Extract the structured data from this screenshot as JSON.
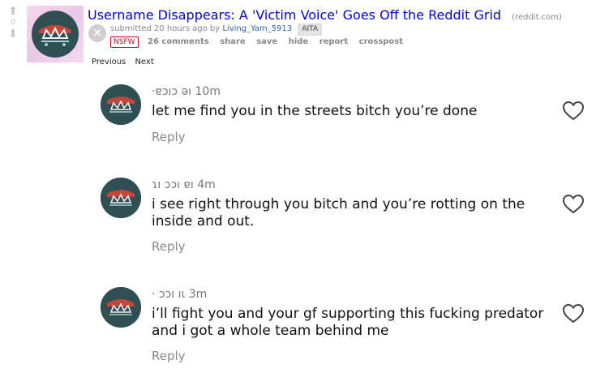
{
  "post": {
    "score": "0",
    "title": "Username Disappears: A 'Victim Voice' Goes Off the Reddit Grid",
    "domain": "(reddit.com)",
    "submitted_prefix": "submitted 20 hours ago by",
    "author": "Living_Yam_5913",
    "flair": "AITA",
    "nsfw": "NSFW",
    "comments": "26 comments",
    "actions": [
      "share",
      "save",
      "hide",
      "report",
      "crosspost"
    ],
    "prev": "Previous",
    "next": "Next"
  },
  "comments": [
    {
      "meta": "·ɐɔıɔ ǝı 10m",
      "text": "let me find you in the streets bitch you’re done",
      "reply": "Reply"
    },
    {
      "meta": "ɿı ɔɔı ɐı 4m",
      "text": "i see right through you bitch and you’re rotting on the inside and out.",
      "reply": "Reply"
    },
    {
      "meta": "· ɔɔı ıɩ 3m",
      "text": "i’ll fight you and your gf supporting this fucking predator and i got a whole team behind me",
      "reply": "Reply"
    }
  ],
  "icons": {
    "upvote": "up-arrow-icon",
    "downvote": "down-arrow-icon",
    "close": "close-icon",
    "like": "heart-icon"
  },
  "colors": {
    "link": "#0000ee",
    "nsfw": "#d10023",
    "avatar_bg": "#2f4f52",
    "avatar_accent": "#c4453a"
  }
}
